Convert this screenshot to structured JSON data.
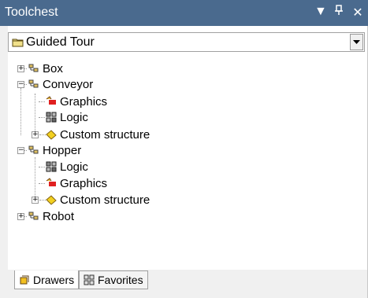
{
  "window": {
    "title": "Toolchest",
    "title_bar_color": "#4a6a8e",
    "buttons": {
      "menu": "▾",
      "pin": "📌",
      "close": "×"
    }
  },
  "combo": {
    "selected": "Guided Tour",
    "icon": "folder-icon"
  },
  "tree": [
    {
      "label": "Box",
      "level": 0,
      "expander": "+",
      "icon": "category-icon"
    },
    {
      "label": "Conveyor",
      "level": 0,
      "expander": "−",
      "icon": "category-icon"
    },
    {
      "label": "Graphics",
      "level": 1,
      "expander": null,
      "icon": "graphics-icon"
    },
    {
      "label": "Logic",
      "level": 1,
      "expander": null,
      "icon": "logic-icon"
    },
    {
      "label": "Custom structure",
      "level": 1,
      "expander": "+",
      "icon": "custom-structure-icon"
    },
    {
      "label": "Hopper",
      "level": 0,
      "expander": "−",
      "icon": "category-icon"
    },
    {
      "label": "Logic",
      "level": 1,
      "expander": null,
      "icon": "logic-icon"
    },
    {
      "label": "Graphics",
      "level": 1,
      "expander": null,
      "icon": "graphics-icon"
    },
    {
      "label": "Custom structure",
      "level": 1,
      "expander": "+",
      "icon": "custom-structure-icon"
    },
    {
      "label": "Robot",
      "level": 0,
      "expander": "+",
      "icon": "category-icon"
    }
  ],
  "tabs": [
    {
      "label": "Drawers",
      "active": true,
      "icon": "drawers-icon"
    },
    {
      "label": "Favorites",
      "active": false,
      "icon": "favorites-icon"
    }
  ]
}
